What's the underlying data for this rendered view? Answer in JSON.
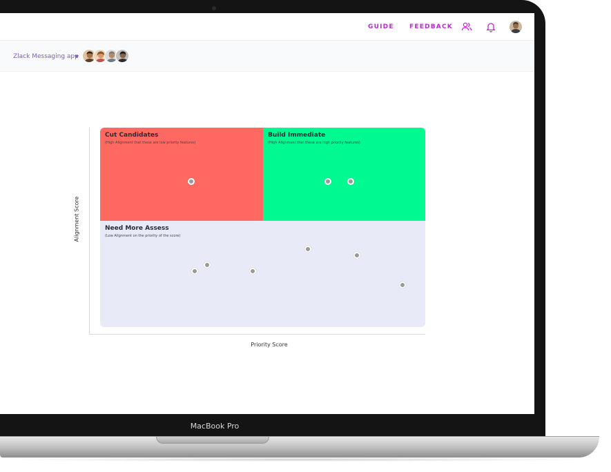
{
  "device": {
    "label": "MacBook Pro"
  },
  "topbar": {
    "guide_label": "GUIDE",
    "feedback_label": "FEEDBACK",
    "accent_color": "#c026d3"
  },
  "project": {
    "name": "Zlack Messaging app",
    "member_count": 4
  },
  "matrix": {
    "y_axis_label": "Alignment Score",
    "x_axis_label": "Priority Score",
    "quadrants": [
      {
        "title": "Cut Candidates",
        "subtitle": "(High Alignment that these are low priority features)",
        "color": "#ff6961"
      },
      {
        "title": "Build Immediate",
        "subtitle": "(High Alignment that these are high priority features)",
        "color": "#00fa92"
      },
      {
        "title": "Need More Assess",
        "subtitle": "(Low Alignment on the priority of the score)",
        "color": "#e8ebf7"
      }
    ],
    "points_note": "plotted feature markers",
    "points": [
      {
        "priority": 0.28,
        "alignment": 0.73
      },
      {
        "priority": 0.7,
        "alignment": 0.73
      },
      {
        "priority": 0.77,
        "alignment": 0.73
      },
      {
        "priority": 0.29,
        "alignment": 0.28
      },
      {
        "priority": 0.33,
        "alignment": 0.31
      },
      {
        "priority": 0.47,
        "alignment": 0.28
      },
      {
        "priority": 0.64,
        "alignment": 0.39
      },
      {
        "priority": 0.79,
        "alignment": 0.36
      },
      {
        "priority": 0.93,
        "alignment": 0.21
      }
    ]
  }
}
